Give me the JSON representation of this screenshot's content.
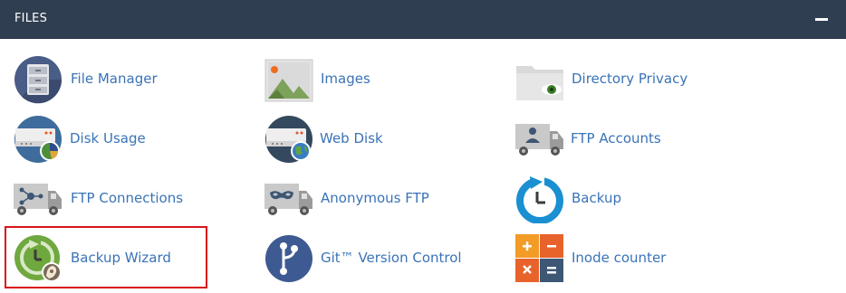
{
  "panel": {
    "title": "FILES",
    "collapse_label": "−"
  },
  "items": [
    {
      "label": "File Manager",
      "icon": "file-manager-icon"
    },
    {
      "label": "Images",
      "icon": "images-icon"
    },
    {
      "label": "Directory Privacy",
      "icon": "directory-privacy-icon"
    },
    {
      "label": "Disk Usage",
      "icon": "disk-usage-icon"
    },
    {
      "label": "Web Disk",
      "icon": "web-disk-icon"
    },
    {
      "label": "FTP Accounts",
      "icon": "ftp-accounts-icon"
    },
    {
      "label": "FTP Connections",
      "icon": "ftp-connections-icon"
    },
    {
      "label": "Anonymous FTP",
      "icon": "anonymous-ftp-icon"
    },
    {
      "label": "Backup",
      "icon": "backup-icon"
    },
    {
      "label": "Backup Wizard",
      "icon": "backup-wizard-icon"
    },
    {
      "label": "Git™ Version Control",
      "icon": "git-version-control-icon"
    },
    {
      "label": "Inode counter",
      "icon": "inode-counter-icon"
    }
  ],
  "highlighted_item": "Backup Wizard",
  "colors": {
    "header_bg": "#2f3e50",
    "link": "#3a73b7",
    "highlight_border": "#d9141b"
  }
}
